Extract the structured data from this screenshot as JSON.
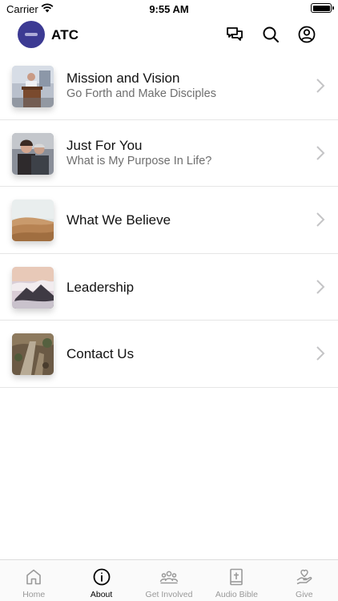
{
  "status": {
    "carrier": "Carrier",
    "time": "9:55 AM"
  },
  "header": {
    "title": "ATC"
  },
  "items": [
    {
      "title": "Mission and Vision",
      "subtitle": "Go Forth and Make Disciples"
    },
    {
      "title": "Just For You",
      "subtitle": "What is My Purpose In Life?"
    },
    {
      "title": "What We Believe"
    },
    {
      "title": "Leadership"
    },
    {
      "title": "Contact Us"
    }
  ],
  "tabs": [
    {
      "label": "Home",
      "icon": "home-icon",
      "active": false
    },
    {
      "label": "About",
      "icon": "info-icon",
      "active": true
    },
    {
      "label": "Get Involved",
      "icon": "group-icon",
      "active": false
    },
    {
      "label": "Audio Bible",
      "icon": "bible-icon",
      "active": false
    },
    {
      "label": "Give",
      "icon": "give-hand-icon",
      "active": false
    }
  ],
  "colors": {
    "brand": "#3c3a93",
    "active_tab": "#000000",
    "inactive_tab": "#999999"
  }
}
